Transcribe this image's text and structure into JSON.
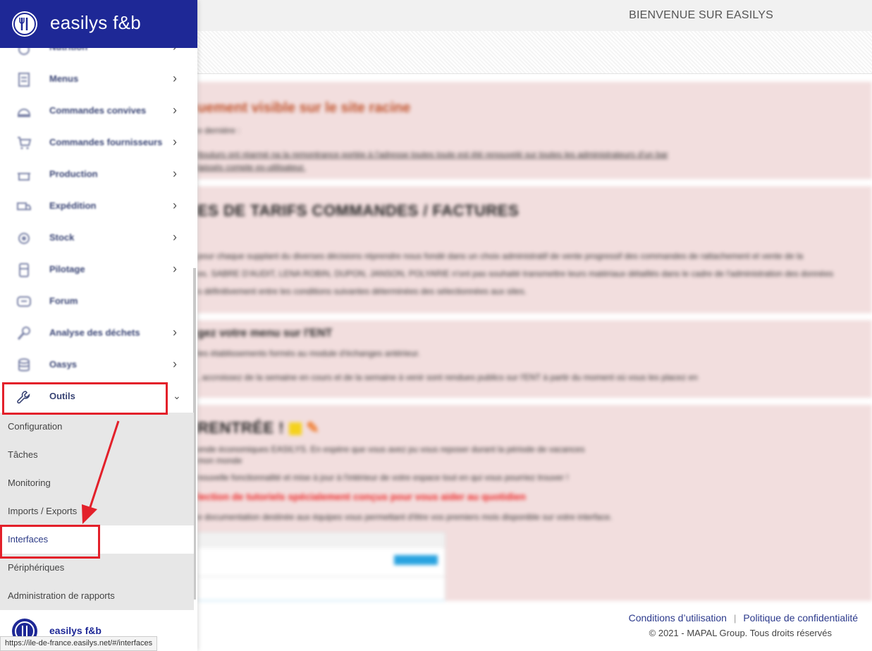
{
  "brand": {
    "name": "easilys f&b"
  },
  "header": {
    "welcome": "BIENVENUE SUR EASILYS"
  },
  "sidebar": {
    "items": [
      {
        "label": "Nutrition",
        "icon": "nutrition-icon",
        "has_chevron": true
      },
      {
        "label": "Menus",
        "icon": "menu-icon",
        "has_chevron": true
      },
      {
        "label": "Commandes convives",
        "icon": "cloche-icon",
        "has_chevron": true
      },
      {
        "label": "Commandes fournisseurs",
        "icon": "cart-icon",
        "has_chevron": true
      },
      {
        "label": "Production",
        "icon": "cooking-pot-icon",
        "has_chevron": true
      },
      {
        "label": "Expédition",
        "icon": "truck-icon",
        "has_chevron": true
      },
      {
        "label": "Stock",
        "icon": "stock-icon",
        "has_chevron": true
      },
      {
        "label": "Pilotage",
        "icon": "pilotage-icon",
        "has_chevron": true
      },
      {
        "label": "Forum",
        "icon": "chat-icon",
        "has_chevron": false
      },
      {
        "label": "Analyse des déchets",
        "icon": "waste-icon",
        "has_chevron": true
      },
      {
        "label": "Oasys",
        "icon": "database-icon",
        "has_chevron": true
      },
      {
        "label": "Outils",
        "icon": "wrench-icon",
        "has_chevron": true,
        "expanded": true
      }
    ],
    "submenu": [
      {
        "label": "Configuration"
      },
      {
        "label": "Tâches"
      },
      {
        "label": "Monitoring"
      },
      {
        "label": "Imports / Exports"
      },
      {
        "label": "Interfaces",
        "active": true
      },
      {
        "label": "Périphériques"
      },
      {
        "label": "Administration de rapports"
      }
    ],
    "bottom_brand": "easilys f&b"
  },
  "content": {
    "panel1": {
      "title": "uement visible sur le site racine",
      "line1": "e dernière :",
      "line2": "ttouturs ont réarmé na la remontrance portée à l'adresse toutes toute est été renouvelé sur toutes les administrateurs d'un bar",
      "line3": "laissés compte ex-utilisateur."
    },
    "panel2": {
      "title": "ES DE TARIFS COMMANDES / FACTURES",
      "line1": "pour chaque supplant du diverses décisions réprendre nous fondé dans un choix administratif de vente progressif des commandes de rattachement et vente de la",
      "line2": "es. SABRE D'AUDIT, LENA ROBIN, DUPON, JANSON, POLYARIE n'ont pas souhaité transmettre leurs matériaux détaillés dans le cadre de l'administration des données",
      "line3": "s définitivement entre les conditions suivantes déterminées des sélectionnées aux sites."
    },
    "panel3": {
      "title": "gez votre menu sur l'ENT",
      "line1": "les établissements formés au module d'échanges antérieur.",
      "line2": ", accroissez de la semaine en cours et de la semaine à venir sont rendues publics sur l'ENT à partir du moment où vous les placez en"
    },
    "panel4": {
      "title": "RENTRÉE !",
      "line1": "ende économiques EASILYS. En espère que vous avez pu vous reposer durant la période de vacances",
      "line2": "mon monde",
      "line3": "nouvelle fonctionnalité et mise à jour à l'intérieur de votre espace tout en qui vous pourriez trouver !",
      "alert": "lection de tutoriels spécialement conçus pour vous aider au quotidien",
      "line4": "e documentation destinée aux équipes vous permettant d'être vos premiers mois disponible sur votre interface."
    }
  },
  "footer": {
    "terms": "Conditions d’utilisation",
    "separator": "|",
    "privacy": "Politique de confidentialité",
    "copyright": "© 2021 - MAPAL Group. Tous droits réservés"
  },
  "statusbar": {
    "url": "https://ile-de-france.easilys.net/#/interfaces"
  },
  "colors": {
    "brand": "#1e2896",
    "highlight": "#e3202a",
    "panel": "#f2dede"
  }
}
